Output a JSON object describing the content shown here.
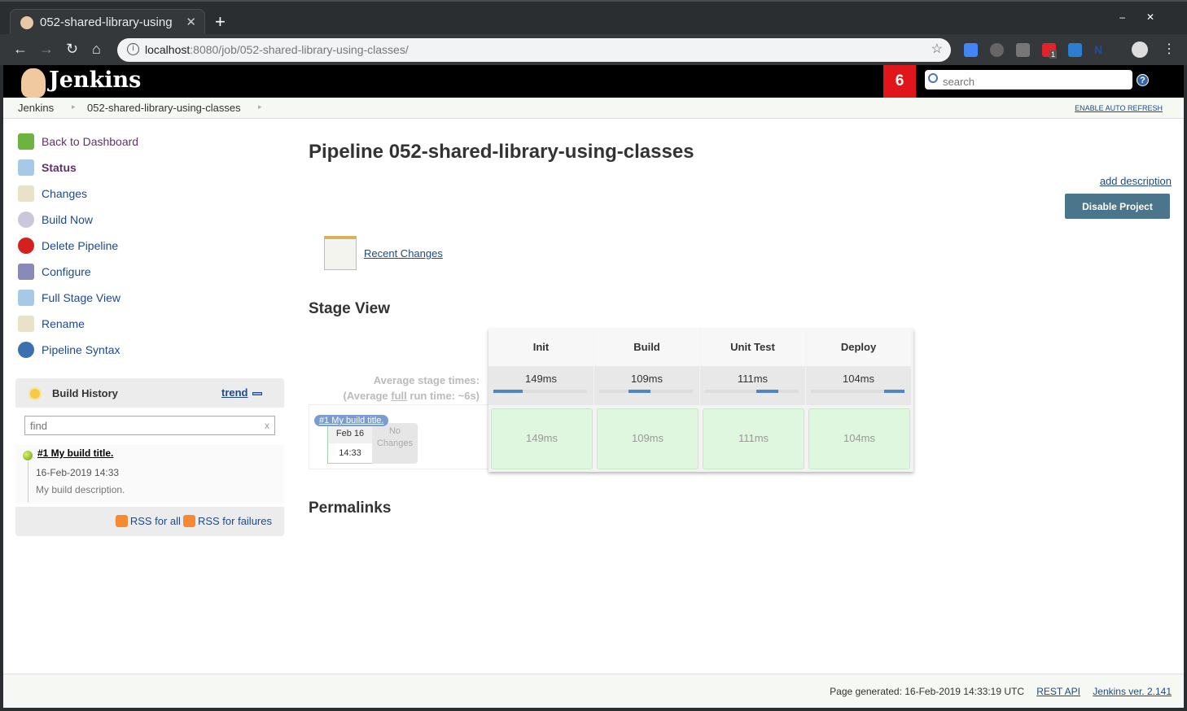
{
  "browser": {
    "tab_title": "052-shared-library-using",
    "url_host": "localhost",
    "url_path": ":8080/job/052-shared-library-using-classes/",
    "extension_badge": "1"
  },
  "header": {
    "logo_text": "Jenkins",
    "notification_count": "6",
    "search_placeholder": "search",
    "help": "?"
  },
  "breadcrumb": {
    "items": [
      "Jenkins",
      "052-shared-library-using-classes"
    ],
    "auto_refresh": "ENABLE AUTO REFRESH"
  },
  "sidebar": {
    "items": [
      {
        "label": "Back to Dashboard",
        "icon": "up-arrow-icon",
        "color": "#6db33f"
      },
      {
        "label": "Status",
        "icon": "magnifier-icon",
        "color": "#a8c8e8"
      },
      {
        "label": "Changes",
        "icon": "notepad-icon",
        "color": "#e8e2c8"
      },
      {
        "label": "Build Now",
        "icon": "clock-play-icon",
        "color": "#c8c8d8"
      },
      {
        "label": "Delete Pipeline",
        "icon": "no-entry-icon",
        "color": "#d42020"
      },
      {
        "label": "Configure",
        "icon": "gear-icon",
        "color": "#8a8ab8"
      },
      {
        "label": "Full Stage View",
        "icon": "magnifier-icon",
        "color": "#a8c8e8"
      },
      {
        "label": "Rename",
        "icon": "notepad-icon",
        "color": "#e8e2c8"
      },
      {
        "label": "Pipeline Syntax",
        "icon": "help-icon",
        "color": "#3a6fb0"
      }
    ]
  },
  "build_history": {
    "title": "Build History",
    "trend": "trend",
    "find_placeholder": "find",
    "clear": "x",
    "builds": [
      {
        "title": "#1 My build title.",
        "date": "16-Feb-2019 14:33",
        "description": "My build description."
      }
    ],
    "rss_all": "RSS for all",
    "rss_failures": "RSS for failures"
  },
  "main": {
    "title": "Pipeline 052-shared-library-using-classes",
    "add_description": "add description",
    "disable_button": "Disable Project",
    "recent_changes": "Recent Changes",
    "stage_view_title": "Stage View",
    "avg_stage_times": "Average stage times:",
    "avg_full_prefix": "(Average ",
    "avg_full_link": "full",
    "avg_full_suffix": " run time: ~6s)",
    "run": {
      "label": "#1 My build title.",
      "date": "Feb 16",
      "time": "14:33",
      "changes": "No Changes"
    },
    "stages": [
      {
        "name": "Init",
        "avg": "149ms",
        "avg_ms": 149,
        "run": "149ms"
      },
      {
        "name": "Build",
        "avg": "109ms",
        "avg_ms": 109,
        "run": "109ms"
      },
      {
        "name": "Unit Test",
        "avg": "111ms",
        "avg_ms": 111,
        "run": "111ms"
      },
      {
        "name": "Deploy",
        "avg": "104ms",
        "avg_ms": 104,
        "run": "104ms"
      }
    ],
    "permalinks_title": "Permalinks"
  },
  "footer": {
    "generated": "Page generated: 16-Feb-2019 14:33:19 UTC",
    "rest_api": "REST API",
    "version": "Jenkins ver. 2.141"
  }
}
